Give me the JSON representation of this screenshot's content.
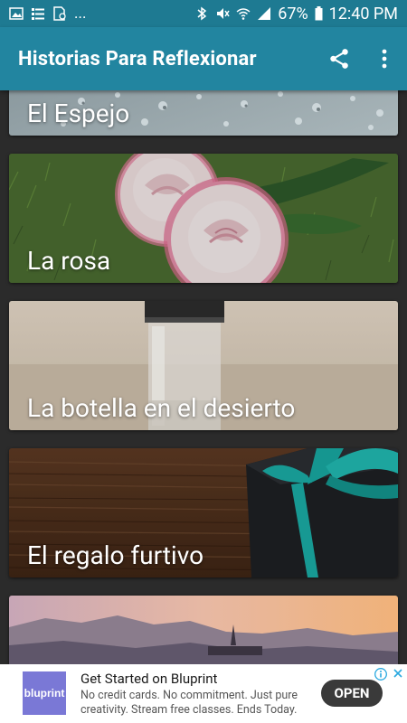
{
  "status_bar": {
    "left_icons": [
      "image-icon",
      "list-icon",
      "file-icon"
    ],
    "more": "...",
    "battery": "67%",
    "time": "12:40 PM"
  },
  "app_bar": {
    "title": "Historias Para Reflexionar",
    "actions": [
      "share-icon",
      "more-vert-icon"
    ]
  },
  "stories": [
    {
      "title": "El Espejo"
    },
    {
      "title": "La rosa"
    },
    {
      "title": "La botella en el desierto"
    },
    {
      "title": "El regalo  furtivo"
    },
    {
      "title": ""
    }
  ],
  "ad": {
    "logo_text": "bluprint",
    "headline": "Get Started on Bluprint",
    "body": "No credit cards. No commitment. Just pure creativity. Stream free classes. Ends Today.",
    "cta": "OPEN"
  },
  "colors": {
    "status_bar": "#1e7a92",
    "app_bar": "#2285a0",
    "background": "#2b2b2b"
  }
}
